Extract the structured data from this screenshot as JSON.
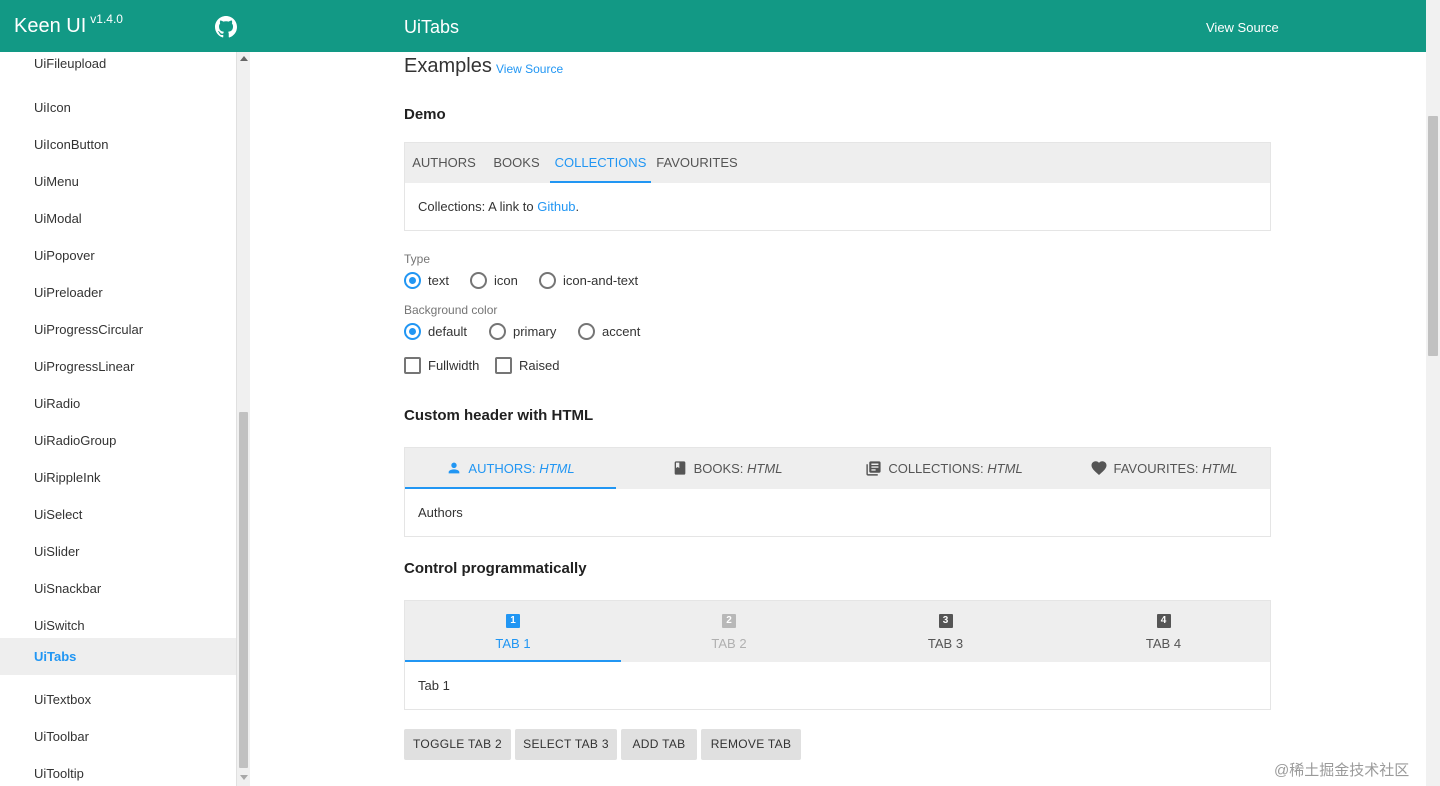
{
  "header": {
    "brand": "Keen UI",
    "version": "v1.4.0",
    "title": "UiTabs",
    "view_source": "View Source"
  },
  "sidebar": {
    "items": [
      {
        "label": "UiFileupload",
        "active": false
      },
      {
        "label": "UiIcon",
        "active": false
      },
      {
        "label": "UiIconButton",
        "active": false
      },
      {
        "label": "UiMenu",
        "active": false
      },
      {
        "label": "UiModal",
        "active": false
      },
      {
        "label": "UiPopover",
        "active": false
      },
      {
        "label": "UiPreloader",
        "active": false
      },
      {
        "label": "UiProgressCircular",
        "active": false
      },
      {
        "label": "UiProgressLinear",
        "active": false
      },
      {
        "label": "UiRadio",
        "active": false
      },
      {
        "label": "UiRadioGroup",
        "active": false
      },
      {
        "label": "UiRippleInk",
        "active": false
      },
      {
        "label": "UiSelect",
        "active": false
      },
      {
        "label": "UiSlider",
        "active": false
      },
      {
        "label": "UiSnackbar",
        "active": false
      },
      {
        "label": "UiSwitch",
        "active": false
      },
      {
        "label": "UiTabs",
        "active": true
      },
      {
        "label": "UiTextbox",
        "active": false
      },
      {
        "label": "UiToolbar",
        "active": false
      },
      {
        "label": "UiTooltip",
        "active": false
      }
    ]
  },
  "main": {
    "examples_title": "Examples",
    "examples_source": "View Source",
    "demo": {
      "title": "Demo",
      "tabs": [
        "AUTHORS",
        "BOOKS",
        "COLLECTIONS",
        "FAVOURITES"
      ],
      "active_tab": "COLLECTIONS",
      "panel_text": "Collections: A link to ",
      "panel_link": "Github",
      "panel_end": "."
    },
    "options": {
      "type_label": "Type",
      "type_options": [
        "text",
        "icon",
        "icon-and-text"
      ],
      "type_selected": "text",
      "bg_label": "Background color",
      "bg_options": [
        "default",
        "primary",
        "accent"
      ],
      "bg_selected": "default",
      "checkboxes": [
        {
          "label": "Fullwidth",
          "checked": false
        },
        {
          "label": "Raised",
          "checked": false
        }
      ]
    },
    "custom_header": {
      "title": "Custom header with HTML",
      "tabs": [
        {
          "label": "AUTHORS: ",
          "em": "HTML",
          "icon": "person-icon"
        },
        {
          "label": "BOOKS: ",
          "em": "HTML",
          "icon": "book-icon"
        },
        {
          "label": "COLLECTIONS: ",
          "em": "HTML",
          "icon": "library-books-icon"
        },
        {
          "label": "FAVOURITES: ",
          "em": "HTML",
          "icon": "heart-icon"
        }
      ],
      "active_tab": "AUTHORS",
      "panel_text": "Authors"
    },
    "control": {
      "title": "Control programmatically",
      "tabs": [
        {
          "num": "1",
          "label": "TAB 1",
          "state": "active"
        },
        {
          "num": "2",
          "label": "TAB 2",
          "state": "disabled"
        },
        {
          "num": "3",
          "label": "TAB 3",
          "state": "normal"
        },
        {
          "num": "4",
          "label": "TAB 4",
          "state": "normal"
        }
      ],
      "panel_text": "Tab 1",
      "buttons": [
        "TOGGLE TAB 2",
        "SELECT TAB 3",
        "ADD TAB",
        "REMOVE TAB"
      ]
    }
  },
  "watermark": "@稀土掘金技术社区",
  "colors": {
    "header_bg": "#129985",
    "accent": "#2196f3",
    "tab_bar_bg": "#eeeeee",
    "button_bg": "#e0e0e0"
  }
}
